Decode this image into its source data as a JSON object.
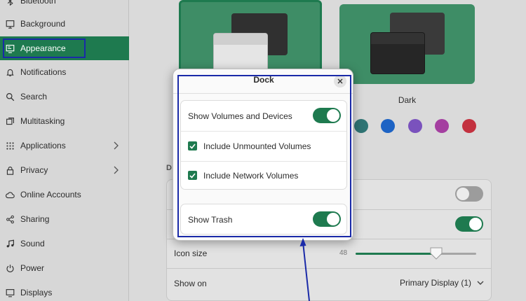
{
  "sidebar": {
    "items": [
      {
        "label": "Bluetooth",
        "icon": "bluetooth-icon"
      },
      {
        "label": "Background",
        "icon": "background-icon"
      },
      {
        "label": "Appearance",
        "icon": "appearance-icon",
        "active": true
      },
      {
        "label": "Notifications",
        "icon": "bell-icon"
      },
      {
        "label": "Search",
        "icon": "search-icon"
      },
      {
        "label": "Multitasking",
        "icon": "multitasking-icon"
      },
      {
        "label": "Applications",
        "icon": "grid-icon",
        "chevron": true
      },
      {
        "label": "Privacy",
        "icon": "lock-icon",
        "chevron": true
      },
      {
        "label": "Online Accounts",
        "icon": "cloud-icon"
      },
      {
        "label": "Sharing",
        "icon": "share-icon"
      },
      {
        "label": "Sound",
        "icon": "music-icon"
      },
      {
        "label": "Power",
        "icon": "power-icon"
      },
      {
        "label": "Displays",
        "icon": "display-icon"
      }
    ]
  },
  "appearance": {
    "style_dark_label": "Dark",
    "accent_colors": [
      "#2f7474",
      "#1d63c4",
      "#7a52bd",
      "#a43fa0",
      "#c3313f"
    ],
    "section_label": "D",
    "icon_size_label": "Icon size",
    "icon_size_value": "48",
    "icon_size_fraction": 0.67,
    "show_on_label": "Show on",
    "show_on_value": "Primary Display (1)"
  },
  "dialog": {
    "title": "Dock",
    "show_volumes_label": "Show Volumes and Devices",
    "show_volumes_on": true,
    "include_unmounted_label": "Include Unmounted Volumes",
    "include_unmounted_checked": true,
    "include_network_label": "Include Network Volumes",
    "include_network_checked": true,
    "show_trash_label": "Show Trash",
    "show_trash_on": true
  },
  "colors": {
    "accent": "#1e7a4f",
    "annotation": "#1a2aa8"
  }
}
